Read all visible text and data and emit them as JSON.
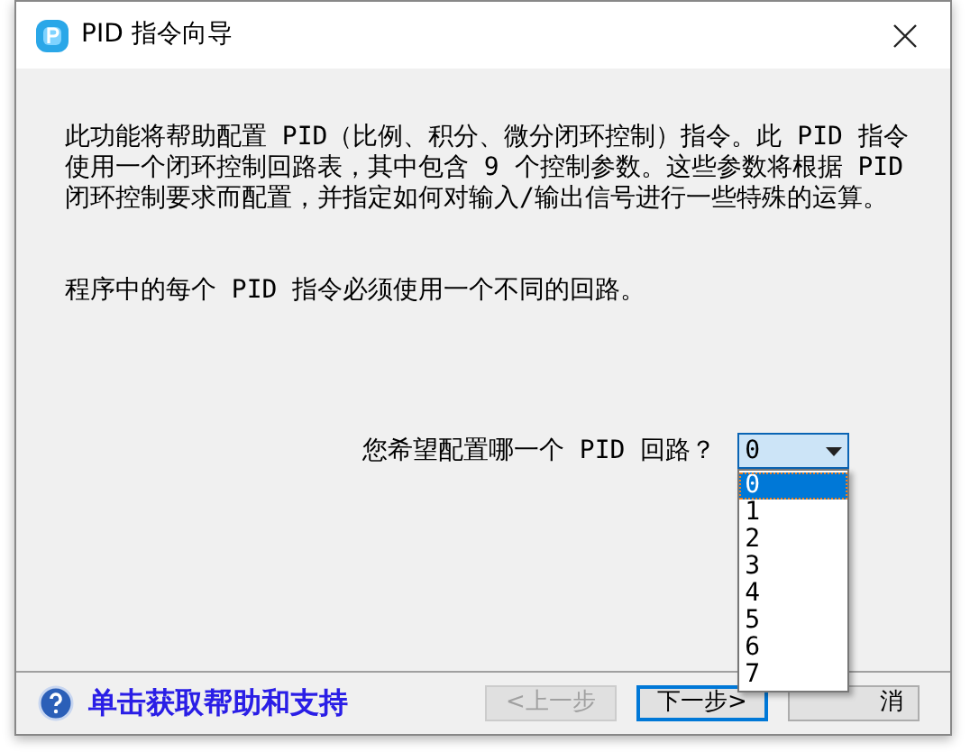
{
  "window": {
    "title": "PID 指令向导"
  },
  "intro": "此功能将帮助配置 PID（比例、积分、微分闭环控制）指令。此 PID 指令使用一个闭环控制回路表，其中包含 9 个控制参数。这些参数将根据 PID 闭环控制要求而配置，并指定如何对输入/输出信号进行一些特殊的运算。",
  "note": "程序中的每个 PID 指令必须使用一个不同的回路。",
  "loop_select": {
    "label": "您希望配置哪一个 PID 回路？",
    "value": "0",
    "expanded": true,
    "options": [
      {
        "label": "0",
        "selected": true
      },
      {
        "label": "1",
        "selected": false
      },
      {
        "label": "2",
        "selected": false
      },
      {
        "label": "3",
        "selected": false
      },
      {
        "label": "4",
        "selected": false
      },
      {
        "label": "5",
        "selected": false
      },
      {
        "label": "6",
        "selected": false
      },
      {
        "label": "7",
        "selected": false
      }
    ]
  },
  "help_link": "单击获取帮助和支持",
  "buttons": [
    {
      "label": "<上一步",
      "disabled": true,
      "default": false
    },
    {
      "label": "下一步>",
      "disabled": false,
      "default": true
    },
    {
      "label": "消",
      "disabled": false,
      "default": false
    }
  ]
}
